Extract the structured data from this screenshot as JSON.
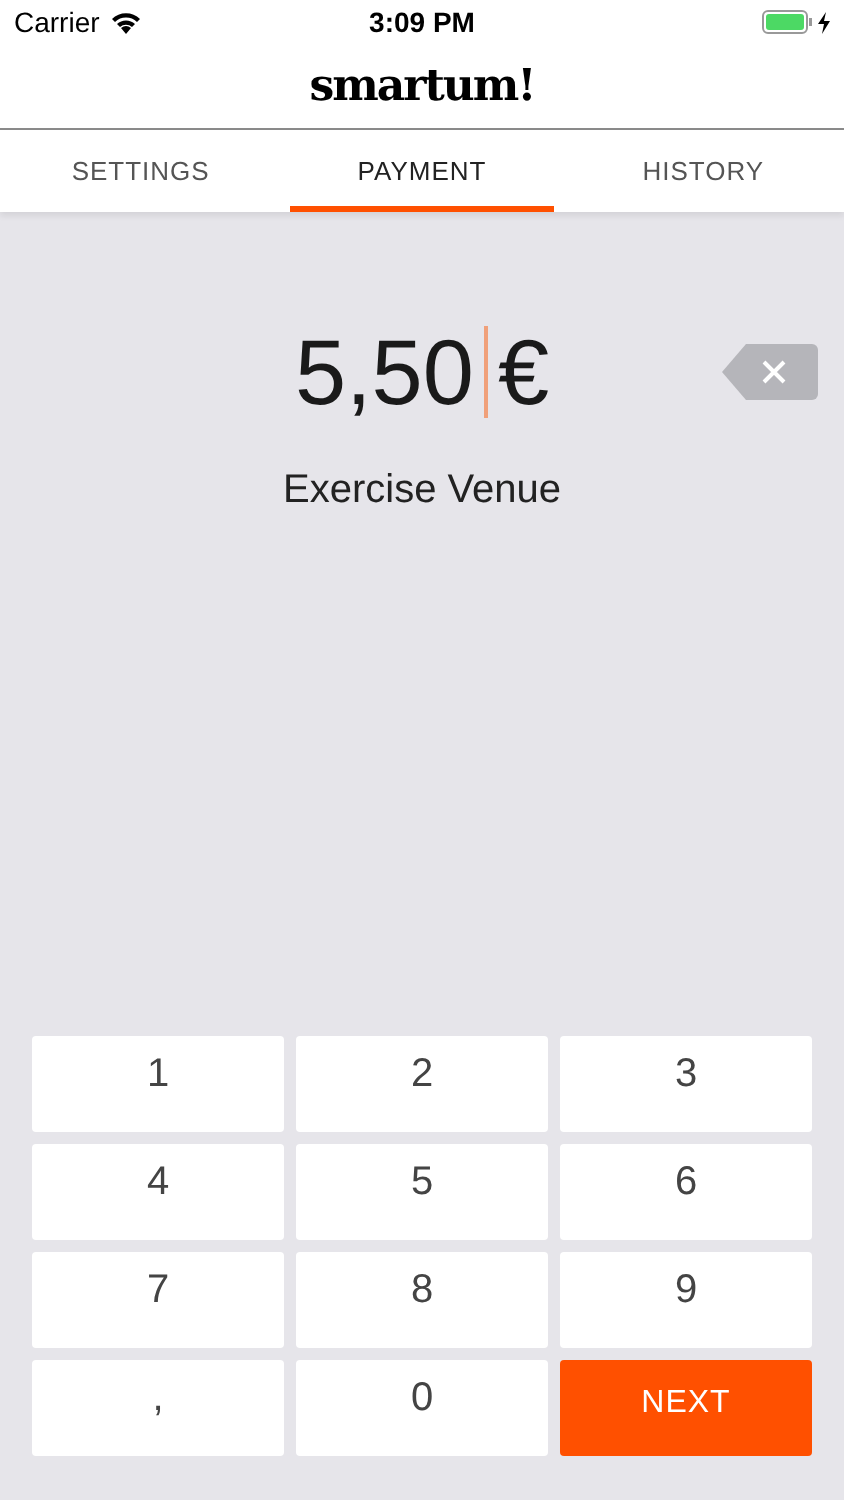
{
  "status_bar": {
    "carrier": "Carrier",
    "time": "3:09 PM"
  },
  "header": {
    "logo": "smartum!"
  },
  "tabs": [
    {
      "label": "SETTINGS",
      "selected": false
    },
    {
      "label": "PAYMENT",
      "selected": true
    },
    {
      "label": "HISTORY",
      "selected": false
    }
  ],
  "amount": {
    "value": "5,50",
    "currency": "€",
    "description": "Exercise Venue"
  },
  "keypad": [
    {
      "label": "1",
      "kind": "digit"
    },
    {
      "label": "2",
      "kind": "digit"
    },
    {
      "label": "3",
      "kind": "digit"
    },
    {
      "label": "4",
      "kind": "digit"
    },
    {
      "label": "5",
      "kind": "digit"
    },
    {
      "label": "6",
      "kind": "digit"
    },
    {
      "label": "7",
      "kind": "digit"
    },
    {
      "label": "8",
      "kind": "digit"
    },
    {
      "label": "9",
      "kind": "digit"
    },
    {
      "label": ",",
      "kind": "digit"
    },
    {
      "label": "0",
      "kind": "digit"
    },
    {
      "label": "NEXT",
      "kind": "primary"
    }
  ]
}
